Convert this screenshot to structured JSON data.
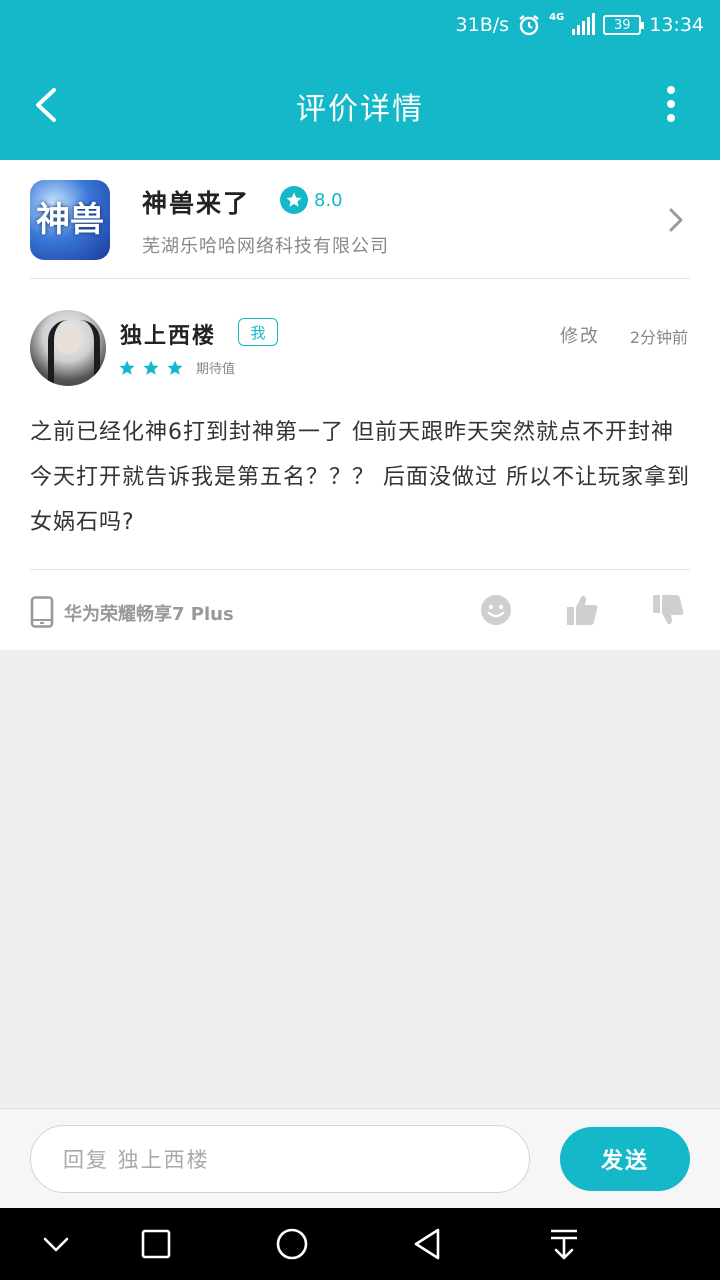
{
  "status": {
    "speed": "31B/s",
    "network": "4G",
    "battery": "39",
    "time": "13:34"
  },
  "header": {
    "title": "评价详情"
  },
  "game": {
    "icon_text": "神兽",
    "name": "神兽来了",
    "rating": "8.0",
    "developer": "芜湖乐哈哈网络科技有限公司"
  },
  "review": {
    "username": "独上西楼",
    "me_tag": "我",
    "star_count": 3,
    "star_label": "期待值",
    "edit_label": "修改",
    "time_ago": "2分钟前",
    "text": "之前已经化神6打到封神第一了 但前天跟昨天突然就点不开封神 今天打开就告诉我是第五名？？？ 后面没做过 所以不让玩家拿到女娲石吗?",
    "device": "华为荣耀畅享7 Plus"
  },
  "reply": {
    "placeholder": "回复 独上西楼",
    "send_label": "发送"
  },
  "colors": {
    "accent": "#14b8c8",
    "icon_gray": "#cfcfcf"
  }
}
